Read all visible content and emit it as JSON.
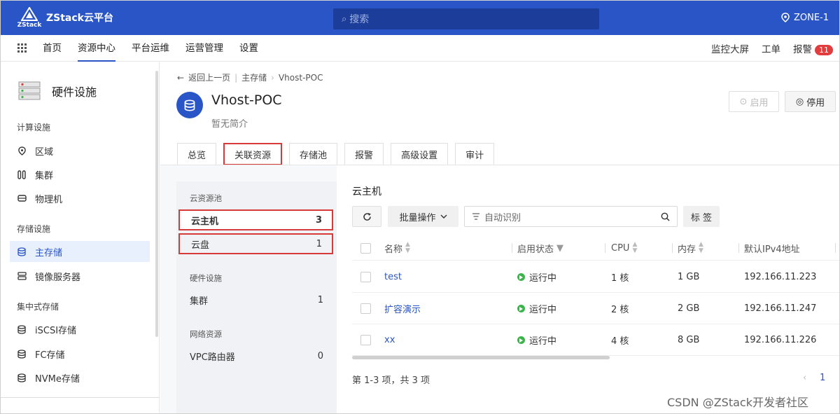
{
  "topbar": {
    "logo_text": "ZStack",
    "brand": "ZStack云平台",
    "search_placeholder": "搜索",
    "zone": "ZONE-1",
    "bg_color": "#2a55c6"
  },
  "nav": {
    "items": [
      "首页",
      "资源中心",
      "平台运维",
      "运营管理",
      "设置"
    ],
    "active": "资源中心",
    "right": {
      "monitor": "监控大屏",
      "ticket": "工单",
      "alarm": "报警",
      "alarm_count": "11"
    }
  },
  "sidebar": {
    "title": "硬件设施",
    "groups": [
      {
        "label": "计算设施",
        "items": [
          {
            "label": "区域",
            "icon": "location-icon"
          },
          {
            "label": "集群",
            "icon": "cluster-icon"
          },
          {
            "label": "物理机",
            "icon": "host-icon"
          }
        ]
      },
      {
        "label": "存储设施",
        "items": [
          {
            "label": "主存储",
            "icon": "database-icon",
            "active": true
          },
          {
            "label": "镜像服务器",
            "icon": "server-icon"
          }
        ]
      },
      {
        "label": "集中式存储",
        "items": [
          {
            "label": "iSCSI存储",
            "icon": "database-icon"
          },
          {
            "label": "FC存储",
            "icon": "database-icon"
          },
          {
            "label": "NVMe存储",
            "icon": "database-icon"
          }
        ]
      }
    ]
  },
  "breadcrumb": {
    "back": "返回上一页",
    "parent": "主存储",
    "current": "Vhost-POC"
  },
  "resource": {
    "name": "Vhost-POC",
    "description": "暂无简介",
    "enable_label": "启用",
    "stop_label": "停用"
  },
  "tabs": [
    "总览",
    "关联资源",
    "存储池",
    "报警",
    "高级设置",
    "审计"
  ],
  "active_tab": "关联资源",
  "subnav": {
    "groups": [
      {
        "label": "云资源池",
        "items": [
          {
            "label": "云主机",
            "count": "3",
            "active": true
          },
          {
            "label": "云盘",
            "count": "1"
          }
        ]
      },
      {
        "label": "硬件设施",
        "items": [
          {
            "label": "集群",
            "count": "1"
          }
        ]
      },
      {
        "label": "网络资源",
        "items": [
          {
            "label": "VPC路由器",
            "count": "0"
          }
        ]
      }
    ]
  },
  "content": {
    "title": "云主机",
    "batch_label": "批量操作",
    "filter_placeholder": "自动识别",
    "tag_label": "标 签",
    "columns": [
      "名称",
      "启用状态",
      "CPU",
      "内存",
      "默认IPv4地址"
    ],
    "rows": [
      {
        "name": "test",
        "status": "运行中",
        "cpu": "1 核",
        "memory": "1 GB",
        "ip": "192.166.11.223"
      },
      {
        "name": "扩容演示",
        "status": "运行中",
        "cpu": "2 核",
        "memory": "2 GB",
        "ip": "192.166.11.247"
      },
      {
        "name": "xx",
        "status": "运行中",
        "cpu": "4 核",
        "memory": "8 GB",
        "ip": "192.166.11.226"
      }
    ],
    "pager_text": "第 1-3 项，共 3 项",
    "pager_prev": "‹",
    "pager_page": "1"
  },
  "watermark": "CSDN @ZStack开发者社区"
}
